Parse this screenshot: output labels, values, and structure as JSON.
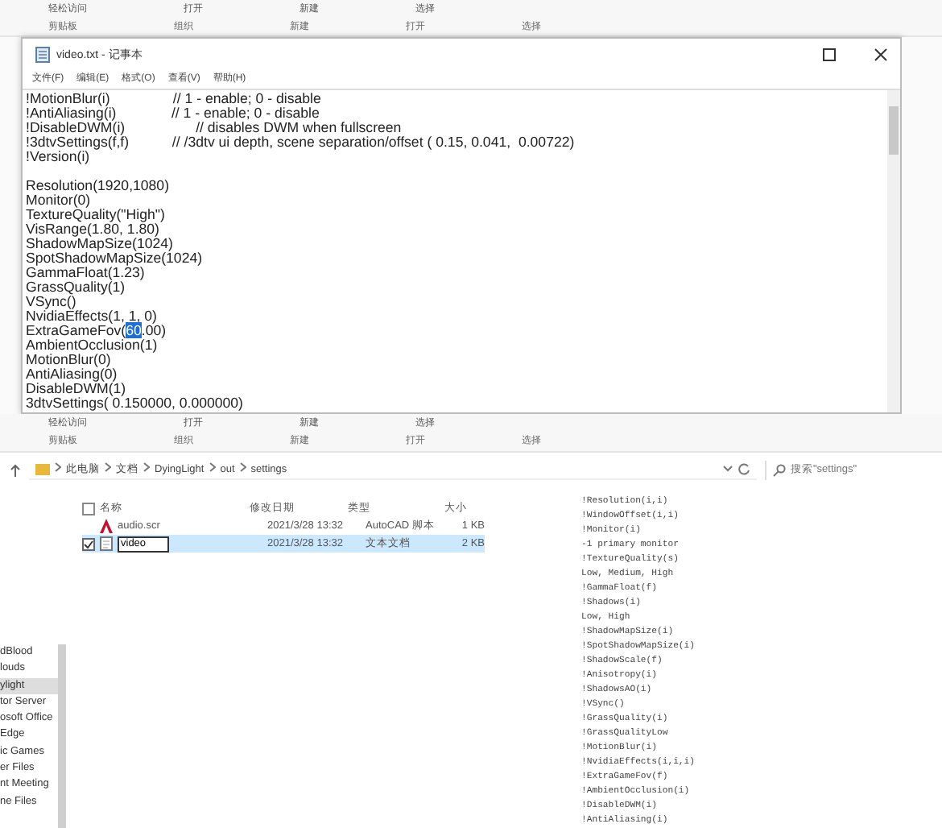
{
  "top_ribbon": {
    "items": [
      "轻松访问",
      "打开",
      "新建",
      "选择"
    ],
    "groups": [
      "剪贴板",
      "组织",
      "新建",
      "打开",
      "选择"
    ]
  },
  "notepad": {
    "title": "video.txt - 记事本",
    "menu": [
      "文件(F)",
      "编辑(E)",
      "格式(O)",
      "查看(V)",
      "帮助(H)"
    ],
    "lines": [
      {
        "text": "!MotionBlur(i)                // 1 - enable; 0 - disable"
      },
      {
        "text": "!AntiAliasing(i)              // 1 - enable; 0 - disable"
      },
      {
        "text": "!DisableDWM(i)                  // disables DWM when fullscreen"
      },
      {
        "text": "!3dtvSettings(f,f)           // /3dtv ui depth, scene separation/offset ( 0.15, 0.041,  0.00722)"
      },
      {
        "text": "!Version(i)"
      },
      {
        "text": "Resolution(1920,1080)",
        "gap_before": true
      },
      {
        "text": "Monitor(0)"
      },
      {
        "text": "TextureQuality(\"High\")"
      },
      {
        "text": "VisRange(1.80, 1.80)"
      },
      {
        "text": "ShadowMapSize(1024)"
      },
      {
        "text": "SpotShadowMapSize(1024)"
      },
      {
        "text": "GammaFloat(1.23)"
      },
      {
        "text": "GrassQuality(1)"
      },
      {
        "text": "VSync()"
      },
      {
        "text": "NvidiaEffects(1, 1, 0)"
      },
      {
        "text": "ExtraGameFov(",
        "selection": "60",
        "after": ".00)"
      },
      {
        "text": "AmbientOcclusion(1)"
      },
      {
        "text": "MotionBlur(0)"
      },
      {
        "text": "AntiAliasing(0)"
      },
      {
        "text": "DisableDWM(1)"
      },
      {
        "text": "3dtvSettings( 0.150000, 0.000000)"
      }
    ]
  },
  "explorer": {
    "ribbon": {
      "items": [
        "轻松访问",
        "打开",
        "新建",
        "选择"
      ],
      "groups": [
        "剪贴板",
        "组织",
        "新建",
        "打开",
        "选择"
      ]
    },
    "breadcrumb": [
      "此电脑",
      "文档",
      "DyingLight",
      "out",
      "settings"
    ],
    "search": {
      "placeholder": "搜索\"settings\""
    },
    "columns": [
      "名称",
      "修改日期",
      "类型",
      "大小"
    ],
    "all_checked": false,
    "files": [
      {
        "name": "audio.scr",
        "date": "2021/3/28 13:32",
        "type": "AutoCAD 脚本",
        "size": "1 KB",
        "kind": "script",
        "selected": false,
        "renaming": false
      },
      {
        "name": "video",
        "date": "2021/3/28 13:32",
        "type": "文本文档",
        "size": "2 KB",
        "kind": "text",
        "selected": true,
        "renaming": true
      }
    ],
    "sidebar": [
      {
        "label": "dBlood",
        "selected": false
      },
      {
        "label": "louds",
        "selected": false
      },
      {
        "label": "ylight",
        "selected": true
      },
      {
        "label": "tor Server",
        "selected": false
      },
      {
        "label": "osoft Office",
        "selected": false
      },
      {
        "label": "Edge",
        "selected": false
      },
      {
        "label": "ic Games",
        "selected": false
      },
      {
        "label": "er Files",
        "selected": false
      },
      {
        "label": "nt Meeting",
        "selected": false
      },
      {
        "label": "ne Files",
        "selected": false
      }
    ],
    "preview": [
      "!Resolution(i,i)",
      "!WindowOffset(i,i)",
      "!Monitor(i)",
      "-1 primary monitor",
      "!TextureQuality(s)",
      "Low, Medium, High",
      "!GammaFloat(f)",
      "!Shadows(i)",
      "Low, High",
      "!ShadowMapSize(i)",
      "!SpotShadowMapSize(i)",
      "!ShadowScale(f)",
      "!Anisotropy(i)",
      "!ShadowsAO(i)",
      "!VSync()",
      "!GrassQuality(i)",
      "!GrassQualityLow",
      "!MotionBlur(i)",
      "!NvidiaEffects(i,i,i)",
      "!ExtraGameFov(f)",
      "!AmbientOcclusion(i)",
      "!DisableDWM(i)",
      "!AntiAliasing(i)"
    ]
  }
}
